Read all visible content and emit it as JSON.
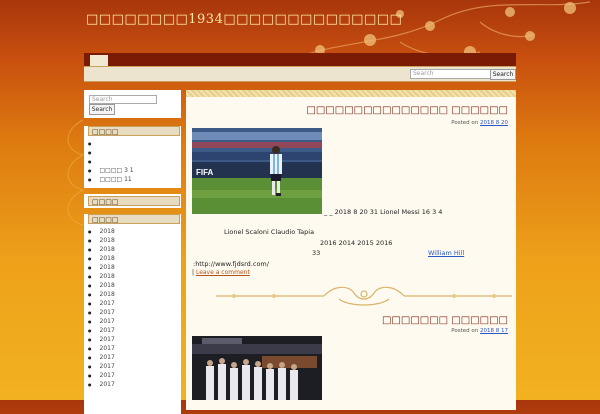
{
  "site": {
    "title": "□□□□□□□□1934□□□□□□□□□□□□□□"
  },
  "header": {
    "search_placeholder": "Search",
    "search_button": "Search"
  },
  "sidebar": {
    "search_placeholder": "Search",
    "search_button": "Search",
    "widget1": {
      "title": "□□□□",
      "items": [
        "",
        "",
        "",
        "□□□□ 3 1",
        "□□□□ 11"
      ]
    },
    "widget2": {
      "title": "□□□□"
    },
    "archive": {
      "title": "□□□□",
      "items": [
        "2018",
        "2018",
        "2018",
        "2018",
        "2018",
        "2018",
        "2018",
        "2018",
        "2017",
        "2017",
        "2017",
        "2017",
        "2017",
        "2017",
        "2017",
        "2017",
        "2017",
        "2017"
      ]
    }
  },
  "posts": [
    {
      "title": "□□□□□□□□□□□□□□□ □□□□□□",
      "posted_label": "Posted on",
      "date": "2018 8 20",
      "lines": {
        "l1": "_ _   2018 8 20      31              Lionel Messi              16   3 4",
        "l2": "Lionel Scaloni                                        Claudio Tapia",
        "l3": "2016          2014      2015         2016",
        "l4": "33",
        "l4_link": "William Hill",
        "l5": ":http://www.fjdsrd.com/",
        "comment_prefix": "|",
        "comment": "Leave a comment"
      }
    },
    {
      "title": "□□□□□□□ □□□□□□",
      "posted_label": "Posted on",
      "date": "2018 8 17"
    }
  ],
  "colors": {
    "header_bg": "#a8360c",
    "title_text": "#ffe9a6",
    "post_title": "#7a2310",
    "link": "#2a56c6"
  }
}
